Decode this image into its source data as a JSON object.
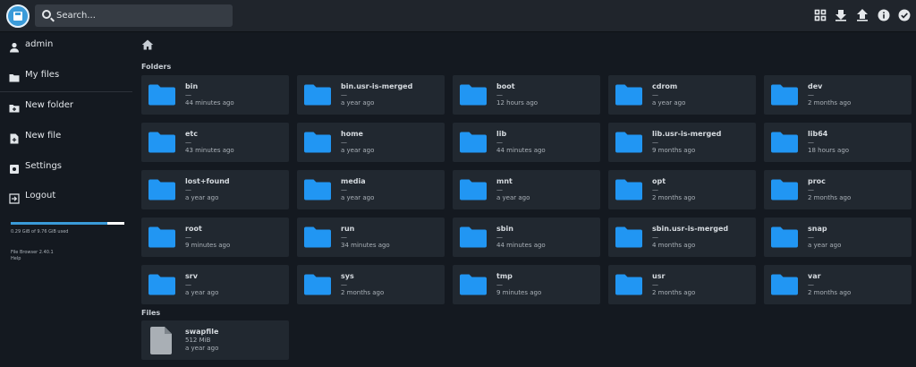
{
  "header": {
    "search_placeholder": "Search...",
    "buttons": [
      "grid-view-icon",
      "download-icon",
      "upload-icon",
      "info-icon",
      "select-all-icon"
    ]
  },
  "sidebar": {
    "user": "admin",
    "items": [
      {
        "label": "My files",
        "icon": "folder-icon"
      },
      {
        "label": "New folder",
        "icon": "new-folder-icon"
      },
      {
        "label": "New file",
        "icon": "new-file-icon"
      },
      {
        "label": "Settings",
        "icon": "gear-icon"
      },
      {
        "label": "Logout",
        "icon": "logout-icon"
      }
    ],
    "usage": "0.29 GiB of 9.76 GiB used",
    "usage_fraction": 0.85,
    "version": "File Browser 2.40.1",
    "help": "Help"
  },
  "main": {
    "folders_title": "Folders",
    "files_title": "Files",
    "folders": [
      {
        "name": "bin",
        "size": "—",
        "modified": "44 minutes ago"
      },
      {
        "name": "bin.usr-is-merged",
        "size": "—",
        "modified": "a year ago"
      },
      {
        "name": "boot",
        "size": "—",
        "modified": "12 hours ago"
      },
      {
        "name": "cdrom",
        "size": "—",
        "modified": "a year ago"
      },
      {
        "name": "dev",
        "size": "—",
        "modified": "2 months ago"
      },
      {
        "name": "etc",
        "size": "—",
        "modified": "43 minutes ago"
      },
      {
        "name": "home",
        "size": "—",
        "modified": "a year ago"
      },
      {
        "name": "lib",
        "size": "—",
        "modified": "44 minutes ago"
      },
      {
        "name": "lib.usr-is-merged",
        "size": "—",
        "modified": "9 months ago"
      },
      {
        "name": "lib64",
        "size": "—",
        "modified": "18 hours ago"
      },
      {
        "name": "lost+found",
        "size": "—",
        "modified": "a year ago"
      },
      {
        "name": "media",
        "size": "—",
        "modified": "a year ago"
      },
      {
        "name": "mnt",
        "size": "—",
        "modified": "a year ago"
      },
      {
        "name": "opt",
        "size": "—",
        "modified": "2 months ago"
      },
      {
        "name": "proc",
        "size": "—",
        "modified": "2 months ago"
      },
      {
        "name": "root",
        "size": "—",
        "modified": "9 minutes ago"
      },
      {
        "name": "run",
        "size": "—",
        "modified": "34 minutes ago"
      },
      {
        "name": "sbin",
        "size": "—",
        "modified": "44 minutes ago"
      },
      {
        "name": "sbin.usr-is-merged",
        "size": "—",
        "modified": "4 months ago"
      },
      {
        "name": "snap",
        "size": "—",
        "modified": "a year ago"
      },
      {
        "name": "srv",
        "size": "—",
        "modified": "a year ago"
      },
      {
        "name": "sys",
        "size": "—",
        "modified": "2 months ago"
      },
      {
        "name": "tmp",
        "size": "—",
        "modified": "9 minutes ago"
      },
      {
        "name": "usr",
        "size": "—",
        "modified": "2 months ago"
      },
      {
        "name": "var",
        "size": "—",
        "modified": "2 months ago"
      }
    ],
    "files": [
      {
        "name": "swapfile",
        "size": "512 MiB",
        "modified": "a year ago"
      }
    ]
  },
  "colors": {
    "accent": "#2196f3",
    "file_icon": "#a9afb5",
    "tile_bg": "#212830"
  }
}
